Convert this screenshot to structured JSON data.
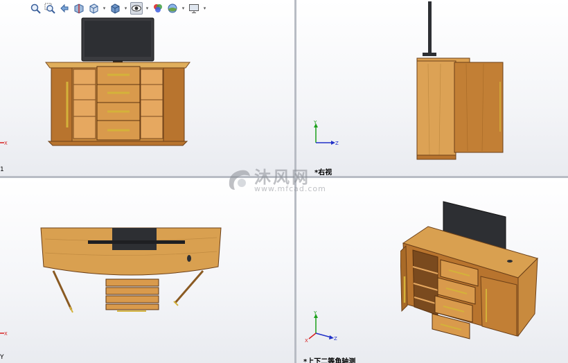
{
  "toolbar": {
    "buttons": [
      {
        "id": "zoom-fit",
        "icon": "zoom-fit-icon"
      },
      {
        "id": "zoom-area",
        "icon": "zoom-area-icon"
      },
      {
        "id": "previous-view",
        "icon": "previous-view-icon"
      },
      {
        "id": "section-view",
        "icon": "section-view-icon"
      },
      {
        "id": "view-orientation",
        "icon": "view-orientation-icon",
        "dropdown": true
      },
      {
        "id": "display-style",
        "icon": "display-style-icon",
        "dropdown": true
      },
      {
        "id": "hide-show-items",
        "icon": "hide-show-icon",
        "dropdown": true,
        "active": true
      },
      {
        "id": "edit-appearance",
        "icon": "appearance-icon"
      },
      {
        "id": "apply-scene",
        "icon": "scene-icon",
        "dropdown": true
      },
      {
        "id": "view-settings",
        "icon": "monitor-icon",
        "dropdown": true
      }
    ]
  },
  "viewports": {
    "front": {
      "label": "",
      "partial_label": "1",
      "triad_axes": [
        "X"
      ]
    },
    "right": {
      "label": "*右视",
      "triad_axes": [
        "Y",
        "Z"
      ]
    },
    "top": {
      "label": "",
      "partial_label": "Y",
      "triad_axes": [
        "X"
      ]
    },
    "iso": {
      "label": "*上下二等角轴测",
      "triad_axes": [
        "Y",
        "Z",
        "X"
      ]
    }
  },
  "watermark": {
    "text": "沐风网",
    "url": "www.mfcad.com"
  },
  "colors": {
    "wood": "#d8a04a",
    "wood_dark": "#a0622a",
    "handle": "#d4b23a",
    "screen": "#2d2f33",
    "axis_x": "#d62020",
    "axis_y": "#1aa01a",
    "axis_z": "#2030c8",
    "background_top": "#ffffff",
    "background_bottom": "#e9ebf0"
  }
}
